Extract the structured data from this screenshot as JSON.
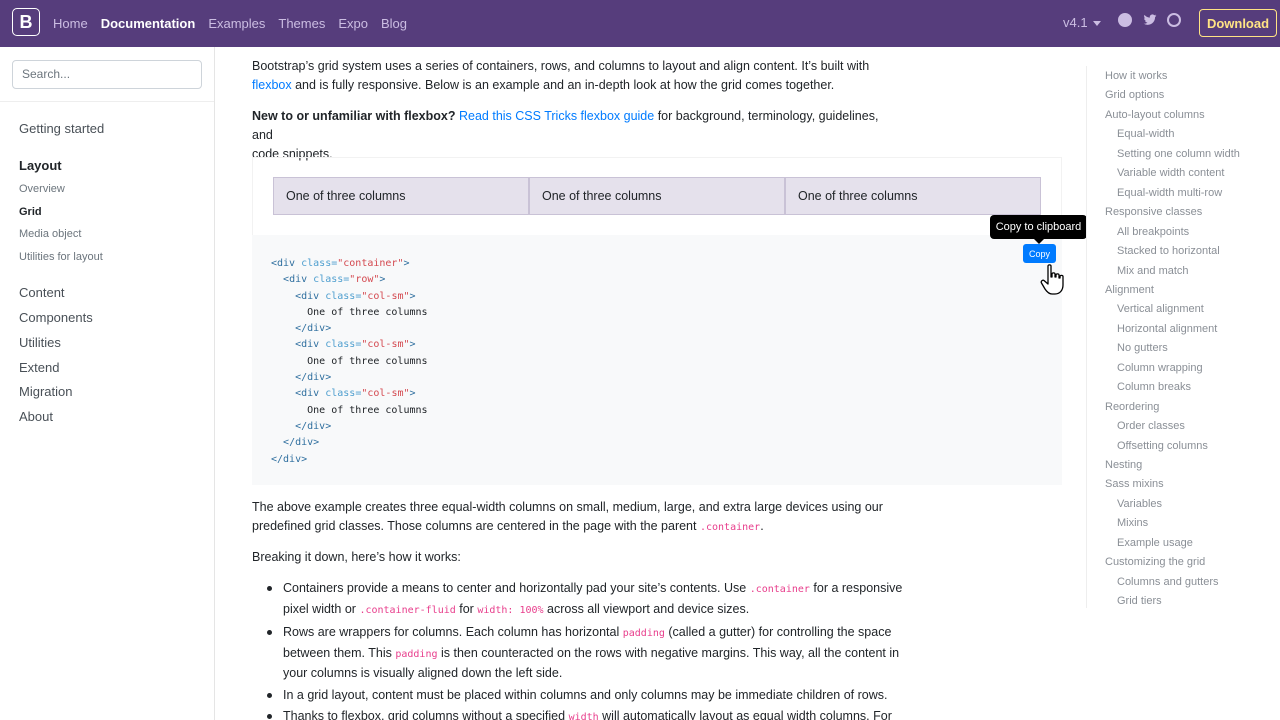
{
  "navbar": {
    "brand": "B",
    "links": [
      {
        "label": "Home",
        "active": false
      },
      {
        "label": "Documentation",
        "active": true
      },
      {
        "label": "Examples",
        "active": false
      },
      {
        "label": "Themes",
        "active": false
      },
      {
        "label": "Expo",
        "active": false
      },
      {
        "label": "Blog",
        "active": false
      }
    ],
    "version": "v4.1",
    "download_label": "Download"
  },
  "sidebar": {
    "search_placeholder": "Search...",
    "getting_started": "Getting started",
    "layout": "Layout",
    "layout_items": [
      "Overview",
      "Grid",
      "Media object",
      "Utilities for layout"
    ],
    "sections": [
      "Content",
      "Components",
      "Utilities",
      "Extend",
      "Migration",
      "About"
    ]
  },
  "main": {
    "intro_1": "Bootstrap’s grid system uses a series of containers, rows, and columns to layout and align content. It’s built with",
    "intro_link": "flexbox",
    "intro_2": " and is fully responsive. Below is an example and an in-depth look at how the grid comes together.",
    "new_bold": "New to or unfamiliar with flexbox?",
    "new_link": "Read this CSS Tricks flexbox guide",
    "new_rest_1": " for background, terminology, guidelines, and",
    "new_rest_2": "code snippets.",
    "columns": [
      "One of three columns",
      "One of three columns",
      "One of three columns"
    ],
    "tooltip": "Copy to clipboard",
    "copy_label": "Copy",
    "after_1": "The above example creates three equal-width columns on small, medium, large, and extra large devices using our",
    "after_2": "predefined grid classes. Those columns are centered in the page with the parent ",
    "after_code": ".container",
    "after_3": ".",
    "breaking": "Breaking it down, here’s how it works:",
    "bullets": {
      "b1_a": "Containers provide a means to center and horizontally pad your site’s contents. Use ",
      "b1_code1": ".container",
      "b1_b": " for a responsive pixel width or ",
      "b1_code2": ".container-fluid",
      "b1_c": " for ",
      "b1_code3": "width: 100%",
      "b1_d": " across all viewport and device sizes.",
      "b2_a": "Rows are wrappers for columns. Each column has horizontal ",
      "b2_code1": "padding",
      "b2_b": " (called a gutter) for controlling the space between them. This ",
      "b2_code2": "padding",
      "b2_c": " is then counteracted on the rows with negative margins. This way, all the content in your columns is visually aligned down the left side.",
      "b3": "In a grid layout, content must be placed within columns and only columns may be immediate children of rows.",
      "b4_a": "Thanks to flexbox, grid columns without a specified ",
      "b4_code": "width",
      "b4_b": " will automatically layout as equal width columns. For"
    }
  },
  "code": {
    "container_class": "\"container\"",
    "row_class": "\"row\"",
    "col_class": "\"col-sm\"",
    "col_text": "One of three columns"
  },
  "toc": [
    {
      "label": "How it works",
      "level": 1
    },
    {
      "label": "Grid options",
      "level": 1
    },
    {
      "label": "Auto-layout columns",
      "level": 1
    },
    {
      "label": "Equal-width",
      "level": 2
    },
    {
      "label": "Setting one column width",
      "level": 2
    },
    {
      "label": "Variable width content",
      "level": 2
    },
    {
      "label": "Equal-width multi-row",
      "level": 2
    },
    {
      "label": "Responsive classes",
      "level": 1
    },
    {
      "label": "All breakpoints",
      "level": 2
    },
    {
      "label": "Stacked to horizontal",
      "level": 2
    },
    {
      "label": "Mix and match",
      "level": 2
    },
    {
      "label": "Alignment",
      "level": 1
    },
    {
      "label": "Vertical alignment",
      "level": 2
    },
    {
      "label": "Horizontal alignment",
      "level": 2
    },
    {
      "label": "No gutters",
      "level": 2
    },
    {
      "label": "Column wrapping",
      "level": 2
    },
    {
      "label": "Column breaks",
      "level": 2
    },
    {
      "label": "Reordering",
      "level": 1
    },
    {
      "label": "Order classes",
      "level": 2
    },
    {
      "label": "Offsetting columns",
      "level": 2
    },
    {
      "label": "Nesting",
      "level": 1
    },
    {
      "label": "Sass mixins",
      "level": 1
    },
    {
      "label": "Variables",
      "level": 2
    },
    {
      "label": "Mixins",
      "level": 2
    },
    {
      "label": "Example usage",
      "level": 2
    },
    {
      "label": "Customizing the grid",
      "level": 1
    },
    {
      "label": "Columns and gutters",
      "level": 2
    },
    {
      "label": "Grid tiers",
      "level": 2
    }
  ],
  "colors": {
    "navbar_bg": "#563d7c",
    "download": "#ffe484",
    "link": "#007bff",
    "code_pink": "#e83e8c"
  }
}
